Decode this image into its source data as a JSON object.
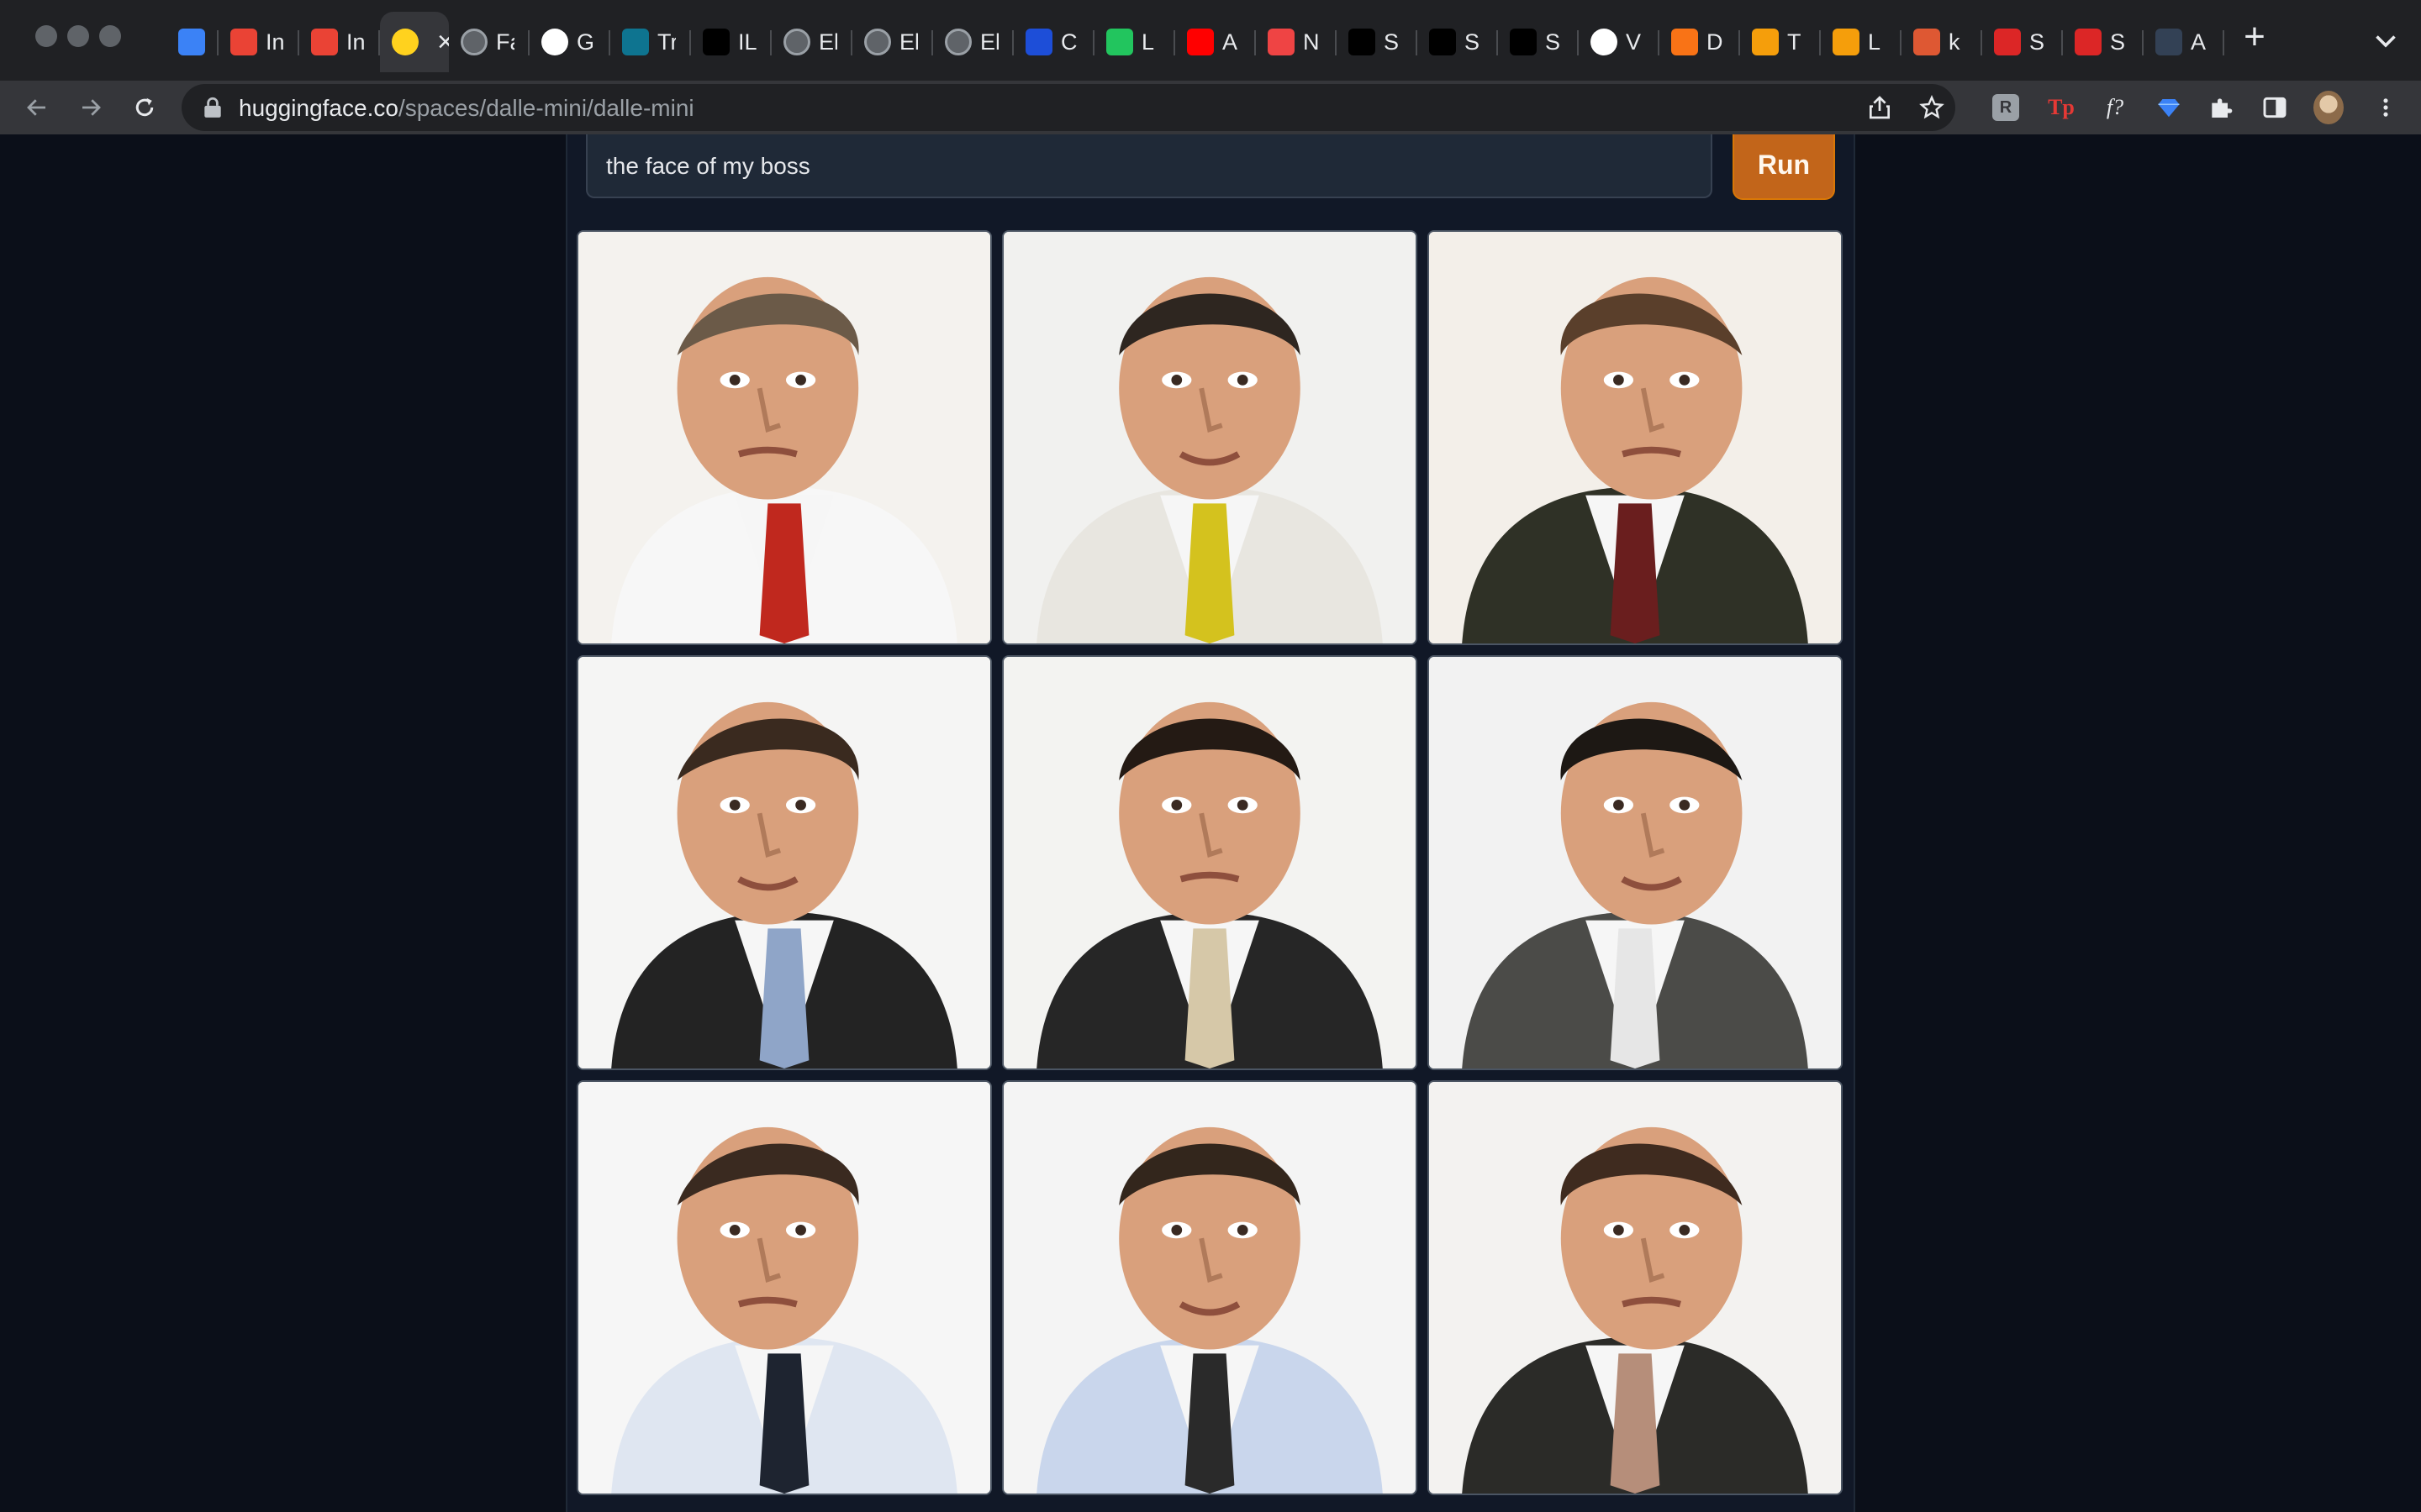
{
  "browser": {
    "tabs": [
      {
        "icon": "gem-icon",
        "label": "",
        "color": "#3b82f6"
      },
      {
        "icon": "gmail-icon",
        "label": "In",
        "color": "#ea4335"
      },
      {
        "icon": "gmail-icon",
        "label": "In",
        "color": "#ea4335"
      },
      {
        "icon": "hugging-face-icon",
        "label": "",
        "color": "#ffd21e",
        "active": true
      },
      {
        "icon": "globe-icon",
        "label": "Fa",
        "color": "#9aa0a6"
      },
      {
        "icon": "github-icon",
        "label": "G",
        "color": "#ffffff"
      },
      {
        "icon": "t-logo-icon",
        "label": "Tr",
        "color": "#0e7490"
      },
      {
        "icon": "black-square-icon",
        "label": "IL",
        "color": "#000000"
      },
      {
        "icon": "globe-icon",
        "label": "El",
        "color": "#9aa0a6"
      },
      {
        "icon": "globe-icon",
        "label": "El",
        "color": "#9aa0a6"
      },
      {
        "icon": "globe-icon",
        "label": "El",
        "color": "#9aa0a6"
      },
      {
        "icon": "s-logo-icon",
        "label": "C",
        "color": "#1d4ed8"
      },
      {
        "icon": "green-square-icon",
        "label": "L",
        "color": "#22c55e"
      },
      {
        "icon": "youtube-icon",
        "label": "A",
        "color": "#ff0000"
      },
      {
        "icon": "waveform-icon",
        "label": "N",
        "color": "#ef4444"
      },
      {
        "icon": "black-square-icon",
        "label": "S",
        "color": "#000000"
      },
      {
        "icon": "black-square-icon",
        "label": "S",
        "color": "#000000"
      },
      {
        "icon": "black-square-icon",
        "label": "S",
        "color": "#000000"
      },
      {
        "icon": "google-icon",
        "label": "V",
        "color": "#ffffff"
      },
      {
        "icon": "orange-arc-icon",
        "label": "D",
        "color": "#f97316"
      },
      {
        "icon": "notebook-icon",
        "label": "T",
        "color": "#f59e0b"
      },
      {
        "icon": "notebook-icon",
        "label": "L",
        "color": "#f59e0b"
      },
      {
        "icon": "duckduckgo-icon",
        "label": "k",
        "color": "#de5833"
      },
      {
        "icon": "k-logo-icon",
        "label": "S",
        "color": "#dc2626"
      },
      {
        "icon": "k-logo-icon",
        "label": "S",
        "color": "#dc2626"
      },
      {
        "icon": "tds-icon",
        "label": "A",
        "color": "#334155"
      }
    ],
    "address_bar": {
      "host": "huggingface.co",
      "path": "/spaces/dalle-mini/dalle-mini"
    }
  },
  "app": {
    "prompt_value": "the face of my boss",
    "run_label": "Run",
    "accent_color": "#c2651a",
    "images": [
      {
        "alt": "generated image 1",
        "variant": 0
      },
      {
        "alt": "generated image 2",
        "variant": 1
      },
      {
        "alt": "generated image 3",
        "variant": 2
      },
      {
        "alt": "generated image 4",
        "variant": 3
      },
      {
        "alt": "generated image 5",
        "variant": 4
      },
      {
        "alt": "generated image 6",
        "variant": 5
      },
      {
        "alt": "generated image 7",
        "variant": 6
      },
      {
        "alt": "generated image 8",
        "variant": 7
      },
      {
        "alt": "generated image 9",
        "variant": 8
      }
    ]
  }
}
